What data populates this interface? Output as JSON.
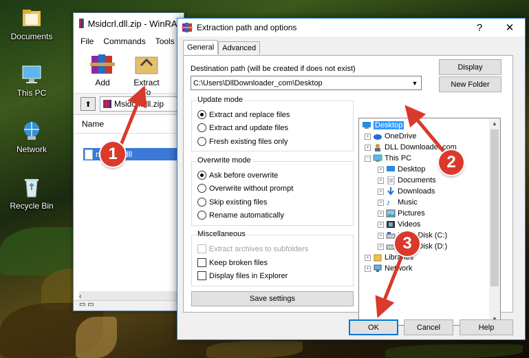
{
  "desktop": {
    "icons": [
      {
        "label": "Documents"
      },
      {
        "label": "This PC"
      },
      {
        "label": "Network"
      },
      {
        "label": "Recycle Bin"
      }
    ]
  },
  "winrar": {
    "title": "Msidcrl.dll.zip - WinRAR",
    "menu": [
      "File",
      "Commands",
      "Tools"
    ],
    "toolbar": {
      "add": "Add",
      "extract_to": "Extract To"
    },
    "path": "Msidcrl.dll.zip",
    "column_name": "Name",
    "file": "msidcrl.dll"
  },
  "dialog": {
    "title": "Extraction path and options",
    "help_glyph": "?",
    "close_glyph": "✕",
    "tabs": [
      "General",
      "Advanced"
    ],
    "dest_label": "Destination path (will be created if does not exist)",
    "dest_value": "C:\\Users\\DllDownloader_com\\Desktop",
    "display_button": "Display",
    "new_folder_button": "New Folder",
    "update_mode": {
      "title": "Update mode",
      "options": [
        "Extract and replace files",
        "Extract and update files",
        "Fresh existing files only"
      ],
      "selected": 0
    },
    "overwrite_mode": {
      "title": "Overwrite mode",
      "options": [
        "Ask before overwrite",
        "Overwrite without prompt",
        "Skip existing files",
        "Rename automatically"
      ],
      "selected": 0
    },
    "misc": {
      "title": "Miscellaneous",
      "options": [
        "Extract archives to subfolders",
        "Keep broken files",
        "Display files in Explorer"
      ]
    },
    "save_settings": "Save settings",
    "tree": {
      "items": [
        "Desktop",
        "OneDrive",
        "DLL Downloader.com",
        "This PC",
        "Desktop",
        "Documents",
        "Downloads",
        "Music",
        "Pictures",
        "Videos",
        "Local Disk (C:)",
        "Local Disk (D:)",
        "Libraries",
        "Network"
      ]
    },
    "buttons": {
      "ok": "OK",
      "cancel": "Cancel",
      "help": "Help"
    }
  },
  "annotations": [
    "1",
    "2",
    "3"
  ],
  "colors": {
    "annotation": "#d93a2b",
    "selection": "#3399ff",
    "dialog_border": "#1f86e0"
  }
}
